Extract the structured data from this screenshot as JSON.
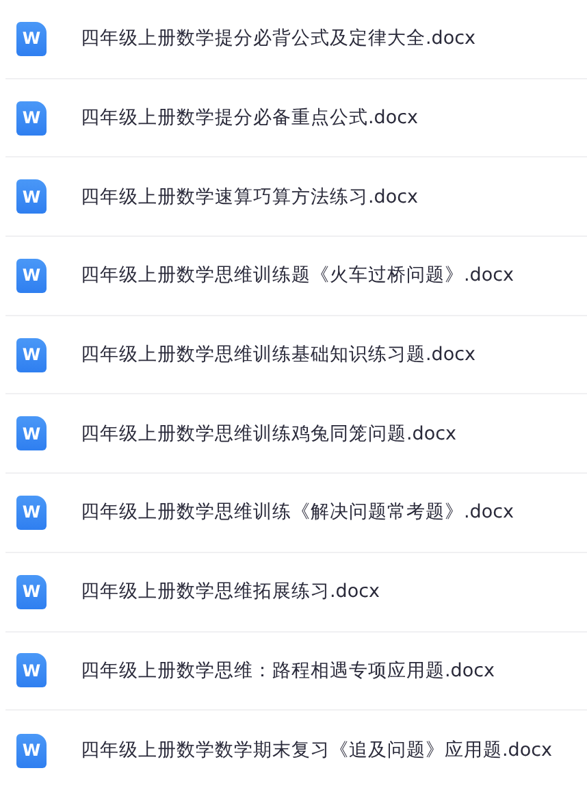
{
  "files": [
    {
      "icon_letter": "W",
      "name": "四年级上册数学提分必背公式及定律大全.docx"
    },
    {
      "icon_letter": "W",
      "name": "四年级上册数学提分必备重点公式.docx"
    },
    {
      "icon_letter": "W",
      "name": "四年级上册数学速算巧算方法练习.docx"
    },
    {
      "icon_letter": "W",
      "name": "四年级上册数学思维训练题《火车过桥问题》.docx"
    },
    {
      "icon_letter": "W",
      "name": "四年级上册数学思维训练基础知识练习题.docx"
    },
    {
      "icon_letter": "W",
      "name": "四年级上册数学思维训练鸡兔同笼问题.docx"
    },
    {
      "icon_letter": "W",
      "name": "四年级上册数学思维训练《解决问题常考题》.docx"
    },
    {
      "icon_letter": "W",
      "name": "四年级上册数学思维拓展练习.docx"
    },
    {
      "icon_letter": "W",
      "name": "四年级上册数学思维：路程相遇专项应用题.docx"
    },
    {
      "icon_letter": "W",
      "name": "四年级上册数学数学期末复习《追及问题》应用题.docx"
    }
  ]
}
